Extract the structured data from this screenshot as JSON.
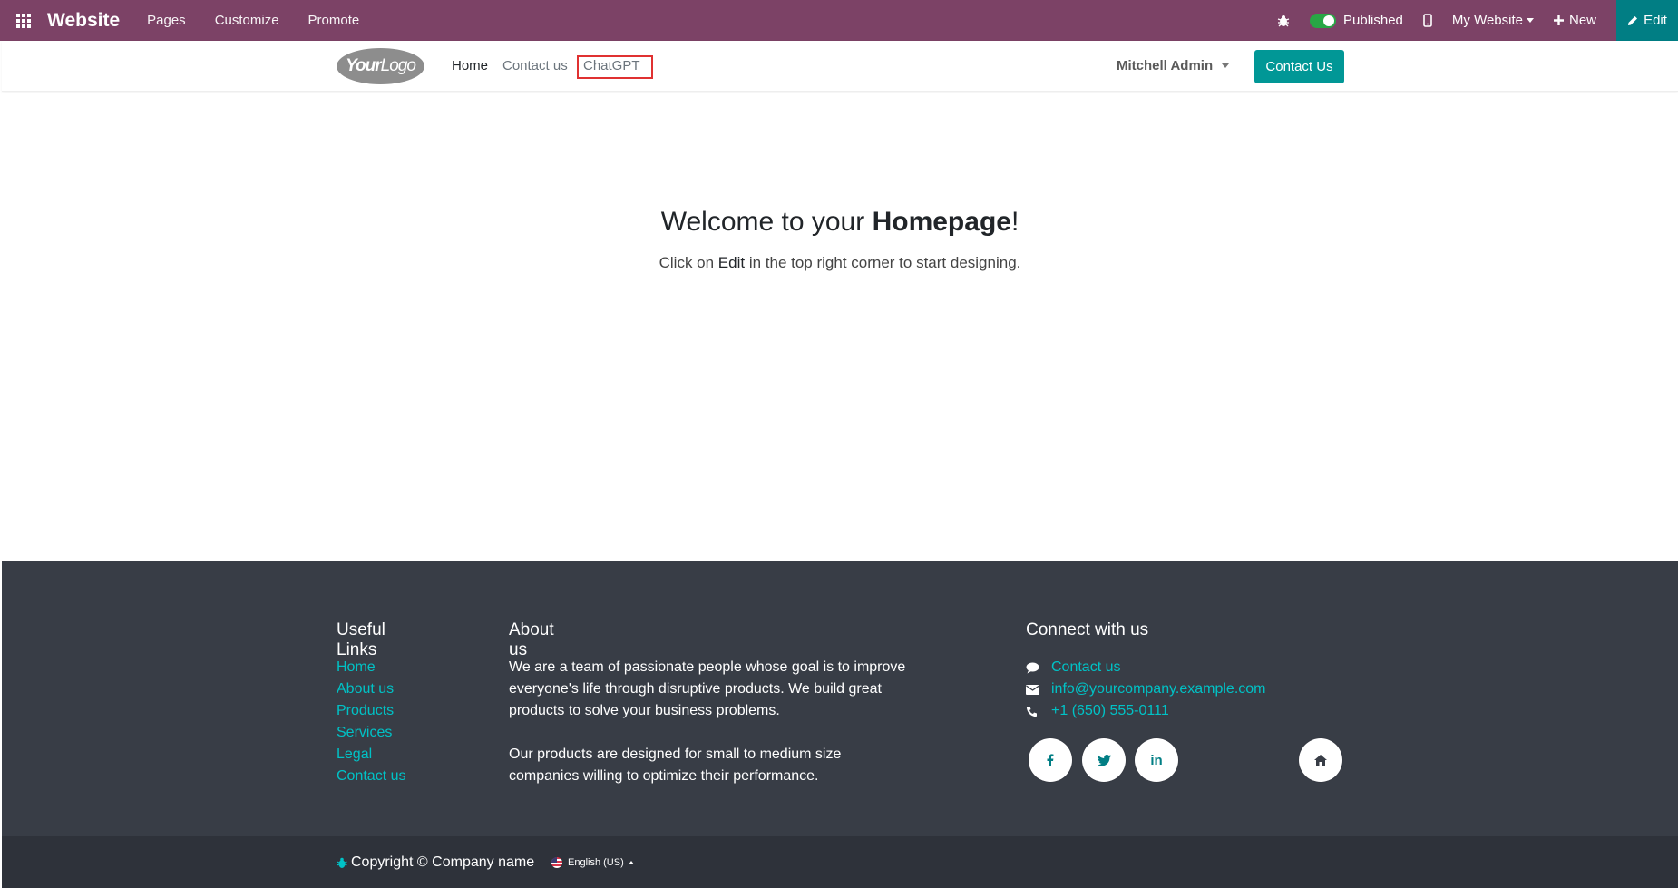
{
  "admin_bar": {
    "brand": "Website",
    "menu": [
      "Pages",
      "Customize",
      "Promote"
    ],
    "published_label": "Published",
    "website_label": "My Website",
    "new_label": "New",
    "edit_label": "Edit",
    "color": "#7c4266"
  },
  "header": {
    "logo_text_bold": "Your",
    "logo_text": "Logo",
    "nav": {
      "home": "Home",
      "contact": "Contact us",
      "chatgpt": "ChatGPT"
    },
    "user": "Mitchell Admin",
    "cta": "Contact Us"
  },
  "hero": {
    "title_pre": "Welcome to your ",
    "title_bold": "Homepage",
    "title_post": "!",
    "sub_pre": "Click on ",
    "sub_bold": "Edit",
    "sub_post": " in the top right corner to start designing."
  },
  "footer": {
    "useful_links": {
      "title": "Useful Links",
      "items": [
        "Home",
        "About us",
        "Products",
        "Services",
        "Legal",
        "Contact us"
      ]
    },
    "about": {
      "title": "About us",
      "p1": "We are a team of passionate people whose goal is to improve everyone's life through disruptive products. We build great products to solve your business problems.",
      "p2": "Our products are designed for small to medium size companies willing to optimize their performance."
    },
    "connect": {
      "title": "Connect with us",
      "contact": "Contact us",
      "email": "info@yourcompany.example.com",
      "phone": "+1 (650) 555-0111",
      "social": [
        "facebook-icon",
        "twitter-icon",
        "linkedin-icon",
        "home-icon"
      ]
    },
    "copyright": "Copyright © Company name",
    "language": "English (US)",
    "link_color": "#00c2c6"
  }
}
